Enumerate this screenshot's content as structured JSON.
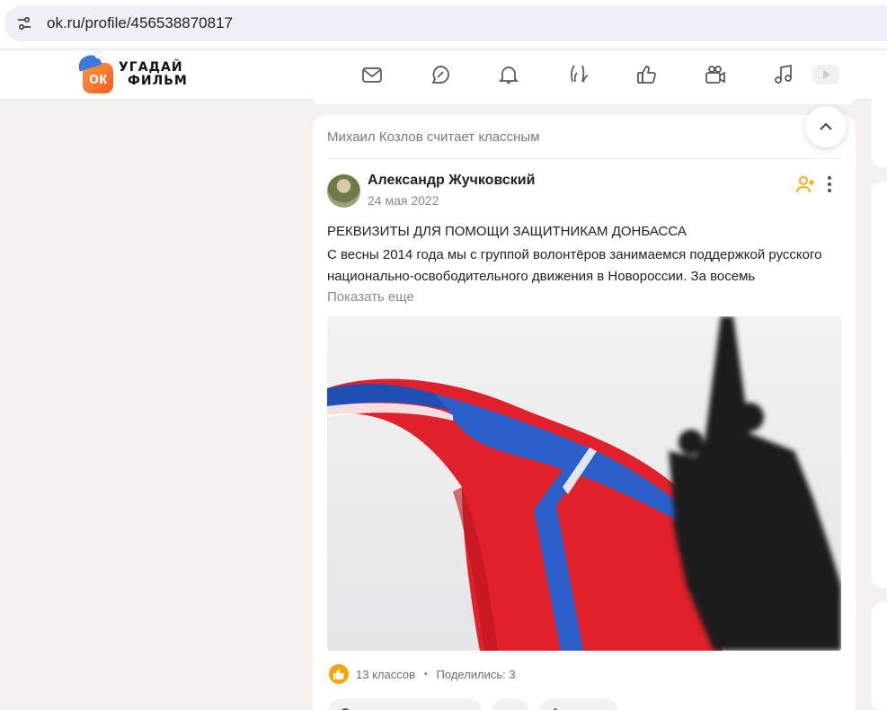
{
  "browser": {
    "url": "ok.ru/profile/456538870817"
  },
  "header": {
    "logo_line1": "УГАДАЙ",
    "logo_line2": "ФИЛЬМ",
    "logo_badge": "ок",
    "nav_icons": [
      "mail-icon",
      "chat-icon",
      "bell-icon",
      "guests-icon",
      "like-icon",
      "video-camera-icon",
      "music-icon",
      "video-icon"
    ]
  },
  "feed": {
    "liked_by": "Михаил Козлов считает классным",
    "post": {
      "author": "Александр Жучковский",
      "date": "24 мая 2022",
      "title": "РЕКВИЗИТЫ ДЛЯ ПОМОЩИ ЗАЩИТНИКАМ ДОНБАССА",
      "body": "С весны 2014 года мы с группой волонтёров занимаемся поддержкой русского национально-освободительного движения в Новороссии. За восемь",
      "show_more": "Показать еще",
      "likes": "13 классов",
      "shares": "Поделились: 3"
    }
  },
  "colors": {
    "page_bg": "#f4f1ee",
    "card_bg": "#ffffff",
    "brand_orange": "#f7a600",
    "muted_text": "#8a8a8a"
  }
}
